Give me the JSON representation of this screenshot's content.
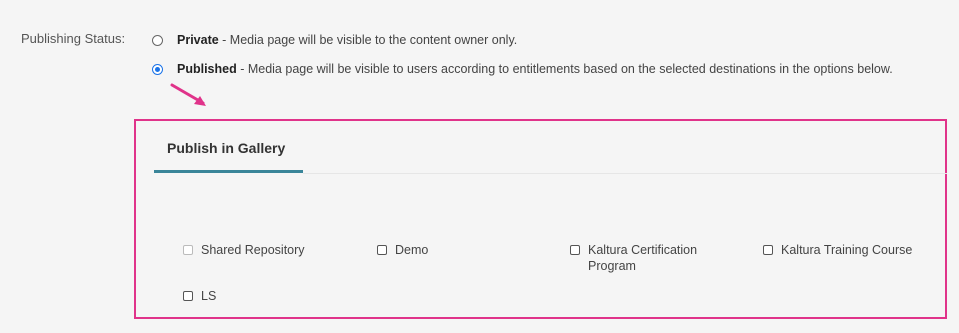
{
  "publishing": {
    "label": "Publishing Status:",
    "options": [
      {
        "name": "Private",
        "description": " - Media page will be visible to the content owner only.",
        "selected": false
      },
      {
        "name": "Published",
        "description": " - Media page will be visible to users according to entitlements based on the selected destinations in the options below.",
        "selected": true
      }
    ]
  },
  "gallery": {
    "tab_label": "Publish in Gallery",
    "items": [
      {
        "label": "Shared Repository",
        "checked": false,
        "disabled": true
      },
      {
        "label": "Demo",
        "checked": false,
        "disabled": false
      },
      {
        "label": "Kaltura Certification Program",
        "checked": false,
        "disabled": false
      },
      {
        "label": "Kaltura Training Course",
        "checked": false,
        "disabled": false
      },
      {
        "label": "LS",
        "checked": false,
        "disabled": false
      }
    ]
  },
  "colors": {
    "highlight_border": "#e0338a",
    "tab_accent": "#3a8599",
    "radio_selected": "#1a73e8"
  },
  "icons": {
    "annotation": "arrow-icon"
  }
}
